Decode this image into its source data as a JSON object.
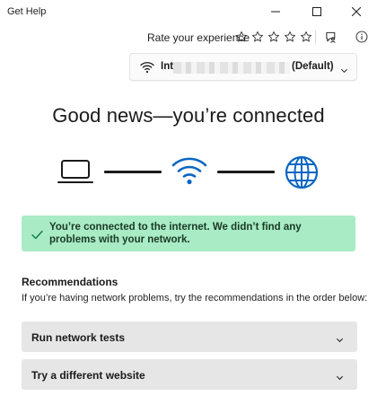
{
  "window": {
    "title": "Get Help"
  },
  "header": {
    "rate_label": "Rate your experience",
    "star_count": 5
  },
  "network": {
    "name_prefix": "Int",
    "name_suffix": "(Default)"
  },
  "status": {
    "headline": "Good news—you’re connected",
    "banner_text": "You’re connected to the internet. We didn’t find any problems with your network.",
    "banner_color": "#a8ebc5",
    "accent_color": "#0a66c2"
  },
  "recommendations": {
    "title": "Recommendations",
    "subtitle": "If you’re having network problems, try the recommendations in the order below:",
    "items": [
      {
        "label": "Run network tests"
      },
      {
        "label": "Try a different website"
      }
    ]
  }
}
